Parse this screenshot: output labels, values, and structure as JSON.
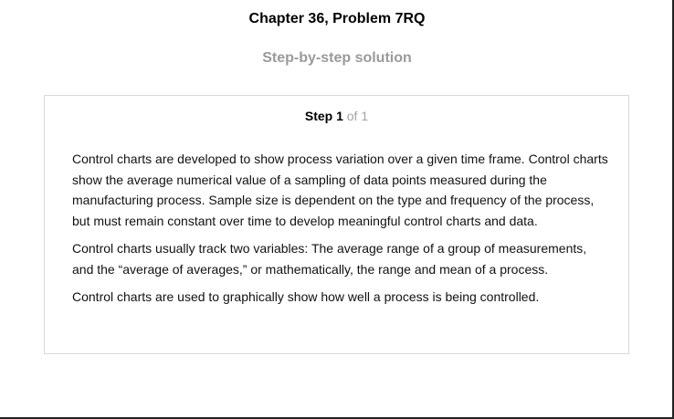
{
  "header": {
    "chapter_title": "Chapter 36, Problem 7RQ",
    "subtitle": "Step-by-step solution"
  },
  "step": {
    "label": "Step 1",
    "of": "of 1",
    "paragraphs": [
      "Control charts are developed to show process variation over a given time frame. Control charts show the average numerical value of a sampling of data points measured during the manufacturing process. Sample size is dependent on the type and frequency of the process, but must remain constant over time to develop meaningful control charts and data.",
      "Control charts usually track two variables: The average range of a group of measurements, and the “average of averages,” or mathematically, the range and mean of a process.",
      "Control charts are used to graphically show how well a process is being controlled."
    ]
  }
}
